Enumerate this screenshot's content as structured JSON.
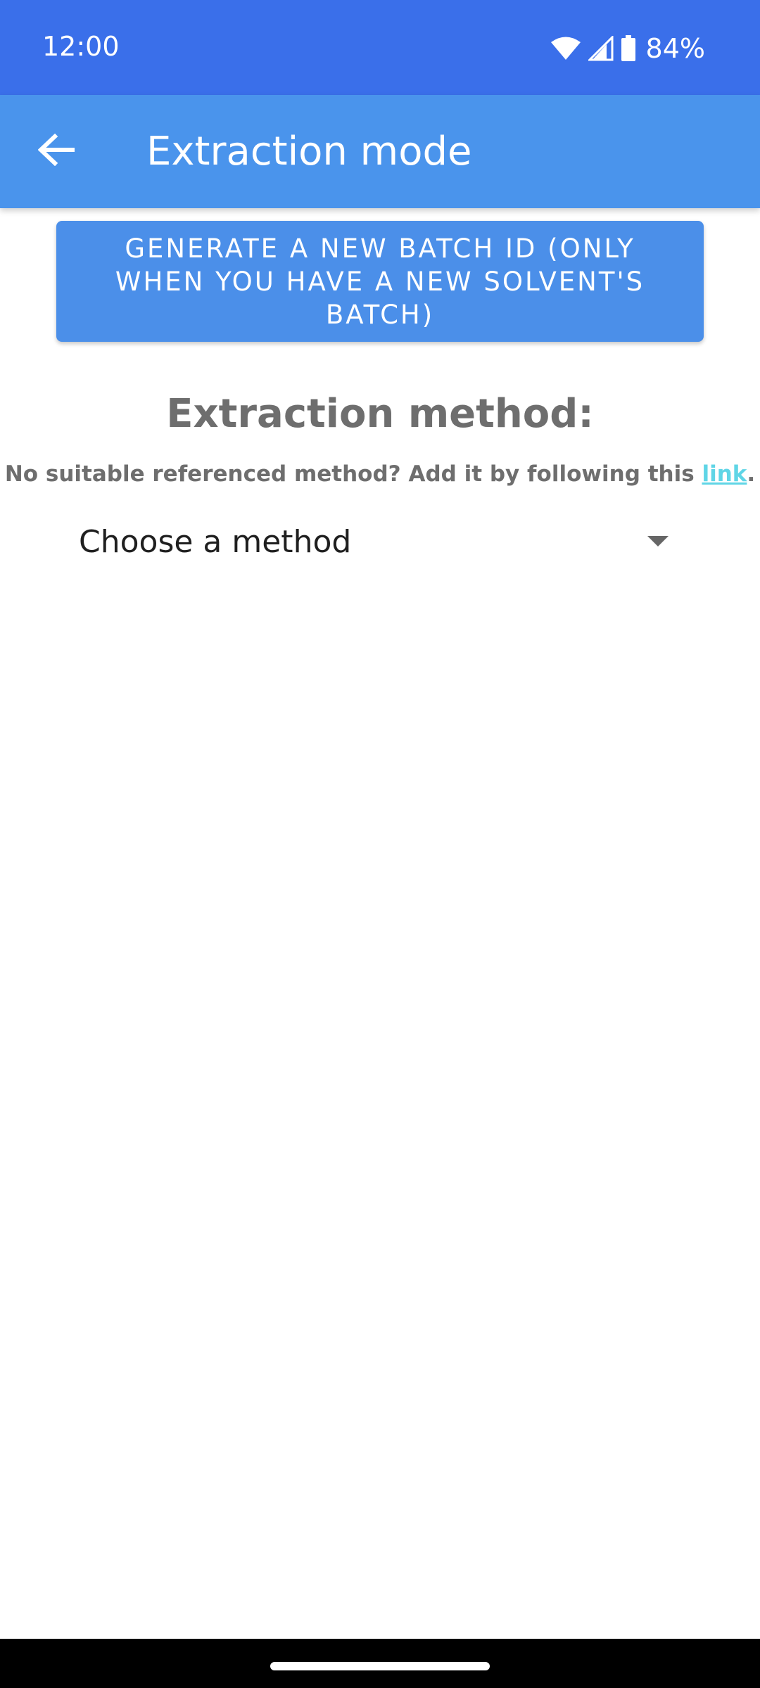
{
  "status_bar": {
    "time": "12:00",
    "battery_percent": "84%",
    "icons": [
      "wifi-icon",
      "cell-signal-icon",
      "battery-icon"
    ]
  },
  "app_bar": {
    "title": "Extraction mode",
    "back_icon": "arrow-back-icon"
  },
  "batch_button": {
    "label": "GENERATE A  NEW BATCH ID (ONLY WHEN YOU HAVE A NEW SOLVENT'S BATCH)"
  },
  "method_section": {
    "heading": "Extraction method:",
    "hint_prefix": "No suitable referenced method? Add it by following this ",
    "hint_link": "link",
    "hint_suffix": "."
  },
  "method_dropdown": {
    "selected": "Choose a method",
    "arrow_icon": "dropdown-arrow-icon"
  },
  "colors": {
    "status_bar": "#3a6fea",
    "app_bar": "#4a94ec",
    "button": "#4b8fe9",
    "heading_text": "#6e6e6e",
    "link": "#5fd5e6"
  }
}
